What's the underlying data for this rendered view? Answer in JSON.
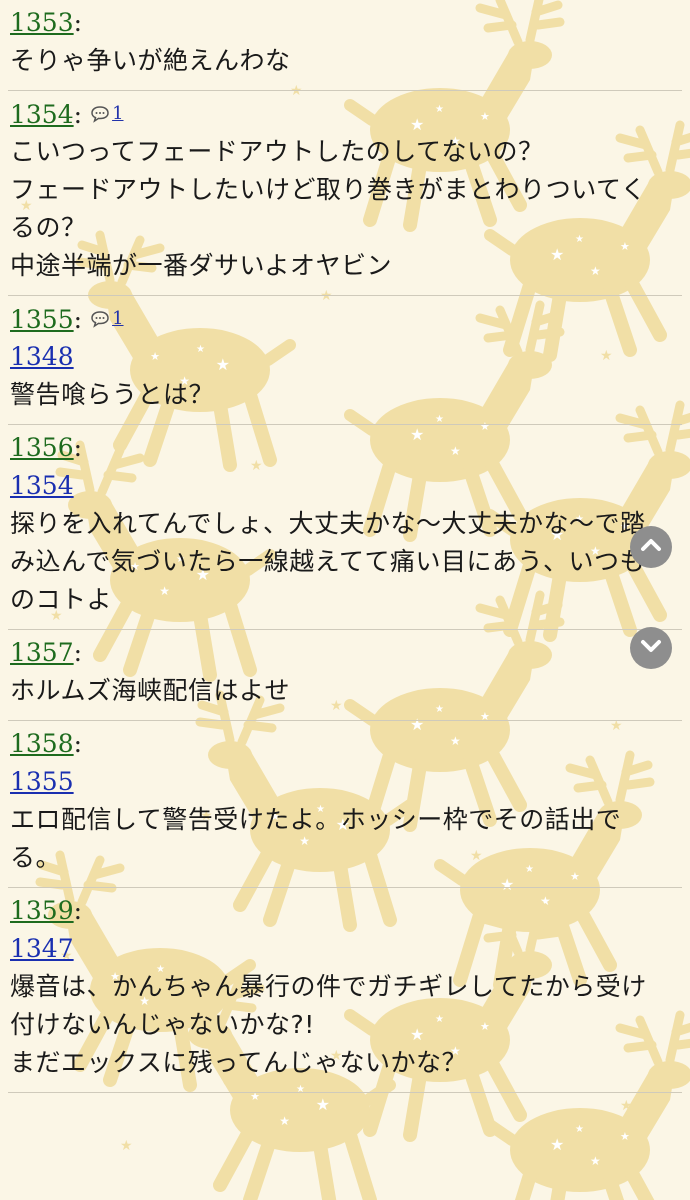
{
  "colors": {
    "background": "#fbf6e6",
    "post_number": "#1e6b1e",
    "link": "#1a2fb0",
    "divider": "#cfcabb",
    "reindeer": "#f1dfa6"
  },
  "icons": {
    "reply": "speech-bubble-icon",
    "scroll_up": "chevron-up-icon",
    "scroll_down": "chevron-down-icon"
  },
  "posts": [
    {
      "number": "1353",
      "anchor": "",
      "reply_count": "",
      "lines": [
        "そりゃ争いが絶えんわな"
      ]
    },
    {
      "number": "1354",
      "anchor": "",
      "reply_count": "1",
      "lines": [
        "こいつってフェードアウトしたのしてないの？",
        "フェードアウトしたいけど取り巻きがまとわりついてく",
        "るの？",
        "中途半端が一番ダサいよオヤビン"
      ]
    },
    {
      "number": "1355",
      "anchor": "1348",
      "reply_count": "1",
      "lines": [
        "警告喰らうとは？"
      ]
    },
    {
      "number": "1356",
      "anchor": "1354",
      "reply_count": "",
      "lines": [
        "探りを入れてんでしょ、大丈夫かな〜大丈夫かな〜で踏",
        "み込んで気づいたら一線越えてて痛い目にあう、いつも",
        "のコトよ"
      ]
    },
    {
      "number": "1357",
      "anchor": "",
      "reply_count": "",
      "lines": [
        "ホルムズ海峡配信はよせ"
      ]
    },
    {
      "number": "1358",
      "anchor": "1355",
      "reply_count": "",
      "lines": [
        "エロ配信して警告受けたよ。ホッシー枠でその話出で",
        "る。"
      ]
    },
    {
      "number": "1359",
      "anchor": "1347",
      "reply_count": "",
      "lines": [
        "爆音は、かんちゃん暴行の件でガチギレしてたから受け",
        "付けないんじゃないかな?!",
        "まだエックスに残ってんじゃないかな？"
      ]
    }
  ]
}
